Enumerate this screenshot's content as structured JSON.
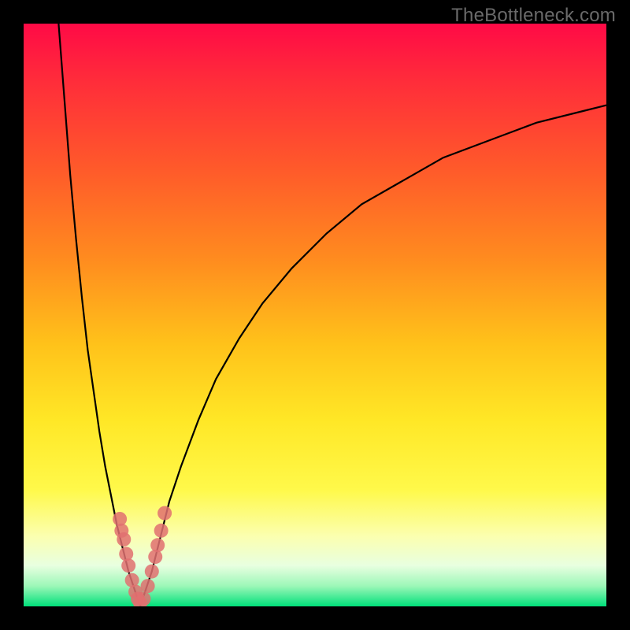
{
  "watermark": {
    "text": "TheBottleneck.com"
  },
  "colors": {
    "frame": "#000000",
    "curve": "#000000",
    "marker_fill": "#e17070",
    "marker_stroke": "#7a2d2d",
    "gradient_stops": [
      {
        "offset": 0.0,
        "color": "#ff0a46"
      },
      {
        "offset": 0.1,
        "color": "#ff2d3a"
      },
      {
        "offset": 0.25,
        "color": "#ff5a2a"
      },
      {
        "offset": 0.4,
        "color": "#ff8a1f"
      },
      {
        "offset": 0.55,
        "color": "#ffc21a"
      },
      {
        "offset": 0.68,
        "color": "#ffe726"
      },
      {
        "offset": 0.8,
        "color": "#fff94a"
      },
      {
        "offset": 0.88,
        "color": "#fbffb0"
      },
      {
        "offset": 0.93,
        "color": "#e8ffe0"
      },
      {
        "offset": 0.965,
        "color": "#9cf7b8"
      },
      {
        "offset": 1.0,
        "color": "#00e07a"
      }
    ]
  },
  "chart_data": {
    "type": "line",
    "title": "",
    "xlabel": "",
    "ylabel": "",
    "xlim": [
      0,
      100
    ],
    "ylim": [
      0,
      100
    ],
    "grid": false,
    "legend": false,
    "x_optimum": 20,
    "series": [
      {
        "name": "left_branch",
        "x": [
          6,
          7,
          8,
          9,
          10,
          11,
          12,
          13,
          14,
          15,
          16,
          17,
          18,
          19,
          20
        ],
        "values": [
          100,
          87,
          74,
          63,
          53,
          44,
          37,
          30,
          24,
          19,
          14,
          10,
          6,
          3,
          0
        ]
      },
      {
        "name": "right_branch",
        "x": [
          20,
          21,
          22,
          23,
          24,
          25,
          27,
          30,
          33,
          37,
          41,
          46,
          52,
          58,
          65,
          72,
          80,
          88,
          96,
          100
        ],
        "values": [
          0,
          3,
          6,
          10,
          14,
          18,
          24,
          32,
          39,
          46,
          52,
          58,
          64,
          69,
          73,
          77,
          80,
          83,
          85,
          86
        ]
      }
    ],
    "markers": [
      {
        "x": 16.5,
        "y": 15
      },
      {
        "x": 16.8,
        "y": 13
      },
      {
        "x": 17.2,
        "y": 11.5
      },
      {
        "x": 17.6,
        "y": 9
      },
      {
        "x": 18.0,
        "y": 7
      },
      {
        "x": 18.6,
        "y": 4.5
      },
      {
        "x": 19.2,
        "y": 2.5
      },
      {
        "x": 19.6,
        "y": 1.3
      },
      {
        "x": 20.0,
        "y": 0.6
      },
      {
        "x": 20.6,
        "y": 1.3
      },
      {
        "x": 21.3,
        "y": 3.5
      },
      {
        "x": 22.0,
        "y": 6
      },
      {
        "x": 22.6,
        "y": 8.5
      },
      {
        "x": 23.0,
        "y": 10.5
      },
      {
        "x": 23.6,
        "y": 13
      },
      {
        "x": 24.2,
        "y": 16
      }
    ]
  }
}
